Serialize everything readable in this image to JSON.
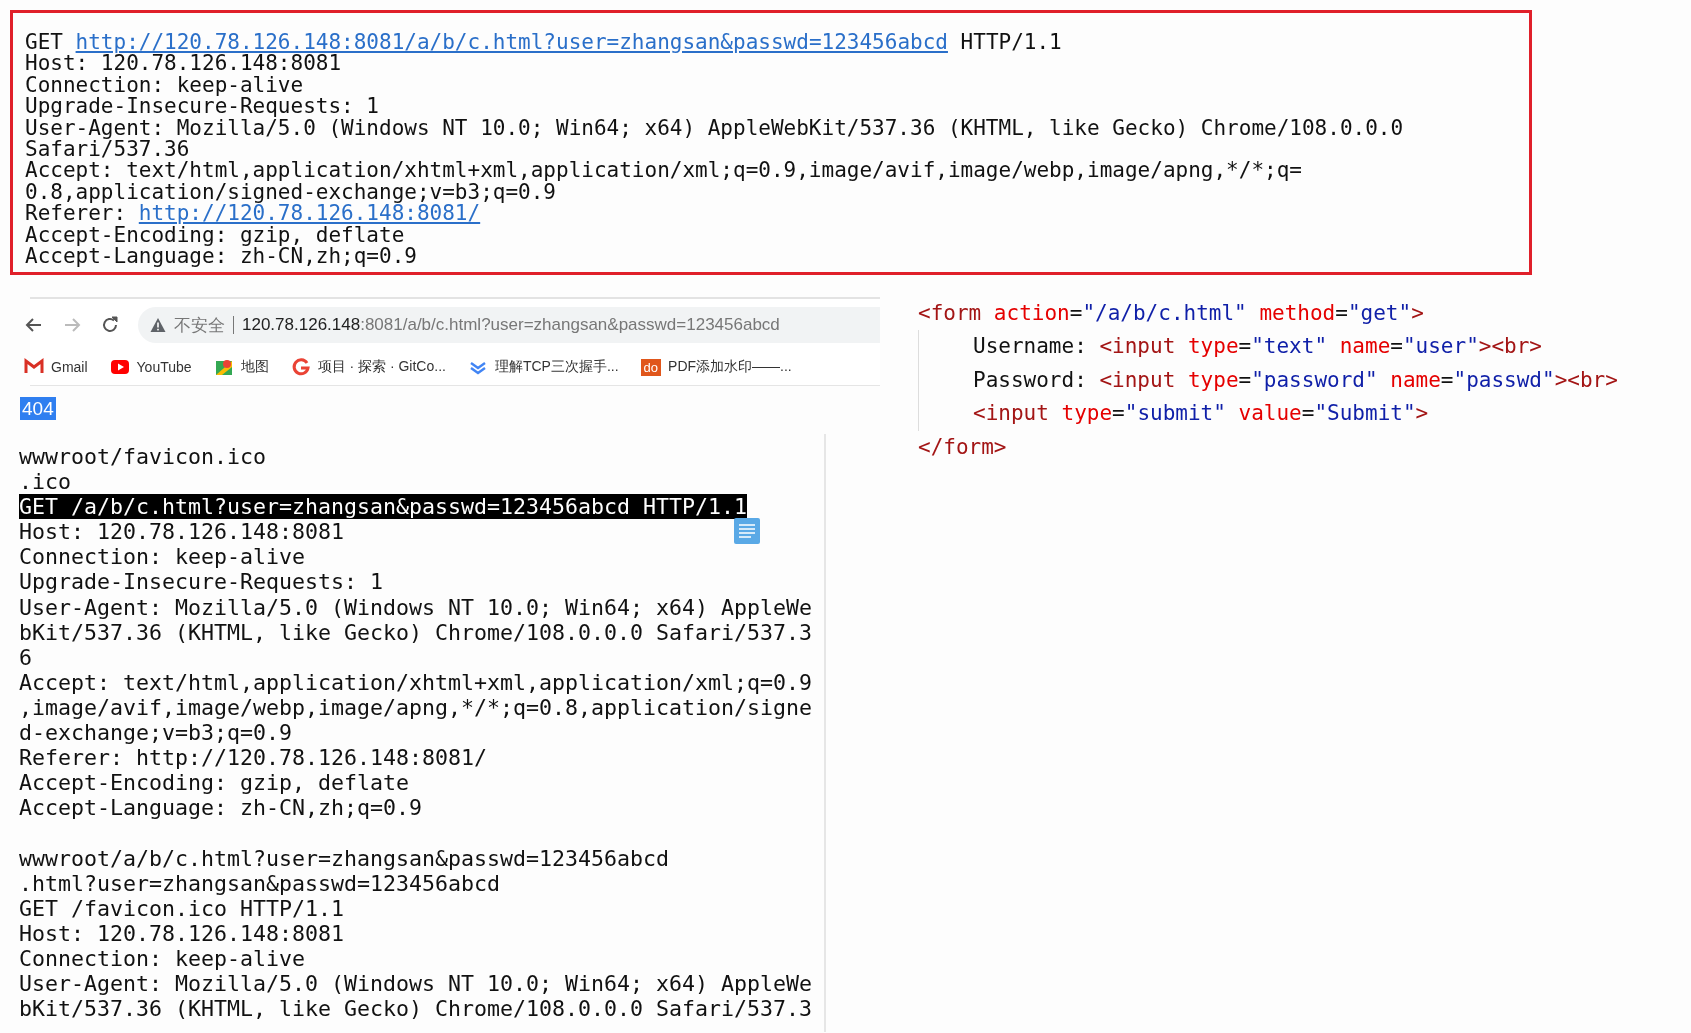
{
  "request_panel": {
    "lines": [
      [
        {
          "kind": "text",
          "text": "GET "
        },
        {
          "kind": "link",
          "text": "http://120.78.126.148:8081/a/b/c.html?user=zhangsan&passwd=123456abcd"
        },
        {
          "kind": "text",
          "text": " HTTP/1.1"
        }
      ],
      [
        {
          "kind": "text",
          "text": "Host: 120.78.126.148:8081"
        }
      ],
      [
        {
          "kind": "text",
          "text": "Connection: keep-alive"
        }
      ],
      [
        {
          "kind": "text",
          "text": "Upgrade-Insecure-Requests: 1"
        }
      ],
      [
        {
          "kind": "text",
          "text": "User-Agent: Mozilla/5.0 (Windows NT 10.0; Win64; x64) AppleWebKit/537.36 (KHTML, like Gecko) Chrome/108.0.0.0"
        }
      ],
      [
        {
          "kind": "text",
          "text": "Safari/537.36"
        }
      ],
      [
        {
          "kind": "text",
          "text": "Accept: text/html,application/xhtml+xml,application/xml;q=0.9,image/avif,image/webp,image/apng,*/*;q="
        }
      ],
      [
        {
          "kind": "text",
          "text": "0.8,application/signed-exchange;v=b3;q=0.9"
        }
      ],
      [
        {
          "kind": "text",
          "text": "Referer: "
        },
        {
          "kind": "link",
          "text": "http://120.78.126.148:8081/"
        }
      ],
      [
        {
          "kind": "text",
          "text": "Accept-Encoding: gzip, deflate"
        }
      ],
      [
        {
          "kind": "text",
          "text": "Accept-Language: zh-CN,zh;q=0.9"
        }
      ]
    ]
  },
  "browser": {
    "nav": [
      {
        "kind": "back",
        "disabled": false
      },
      {
        "kind": "forward",
        "disabled": true
      },
      {
        "kind": "reload",
        "disabled": false
      }
    ],
    "address": {
      "warning": "不安全",
      "host": "120.78.126.148",
      "rest": ":8081/a/b/c.html?user=zhangsan&passwd=123456abcd"
    },
    "bookmarks": [
      {
        "kind": "mail",
        "label": "Gmail"
      },
      {
        "kind": "play",
        "label": "YouTube"
      },
      {
        "kind": "map",
        "label": "地图"
      },
      {
        "kind": "ring",
        "label": "项目 · 探索 · GitCo..."
      },
      {
        "kind": "chevrons",
        "label": "理解TCP三次握手..."
      },
      {
        "kind": "badge",
        "badge_text": "do",
        "label": "PDF添加水印——..."
      }
    ],
    "page_text": {
      "text": "404",
      "selected": true
    }
  },
  "terminal": {
    "lines": [
      {
        "text": "wwwroot/favicon.ico",
        "selected": false
      },
      {
        "text": ".ico",
        "selected": false
      },
      {
        "text": "GET /a/b/c.html?user=zhangsan&passwd=123456abcd HTTP/1.1",
        "selected": true
      },
      {
        "text": "Host: 120.78.126.148:8081",
        "selected": false
      },
      {
        "text": "Connection: keep-alive",
        "selected": false
      },
      {
        "text": "Upgrade-Insecure-Requests: 1",
        "selected": false
      },
      {
        "text": "User-Agent: Mozilla/5.0 (Windows NT 10.0; Win64; x64) AppleWe",
        "selected": false
      },
      {
        "text": "bKit/537.36 (KHTML, like Gecko) Chrome/108.0.0.0 Safari/537.3",
        "selected": false
      },
      {
        "text": "6",
        "selected": false
      },
      {
        "text": "Accept: text/html,application/xhtml+xml,application/xml;q=0.9",
        "selected": false
      },
      {
        "text": ",image/avif,image/webp,image/apng,*/*;q=0.8,application/signe",
        "selected": false
      },
      {
        "text": "d-exchange;v=b3;q=0.9",
        "selected": false
      },
      {
        "text": "Referer: http://120.78.126.148:8081/",
        "selected": false
      },
      {
        "text": "Accept-Encoding: gzip, deflate",
        "selected": false
      },
      {
        "text": "Accept-Language: zh-CN,zh;q=0.9",
        "selected": false
      },
      {
        "text": "wwwroot/a/b/c.html?user=zhangsan&passwd=123456abcd",
        "selected": false,
        "gap_before": true
      },
      {
        "text": ".html?user=zhangsan&passwd=123456abcd",
        "selected": false
      },
      {
        "text": "GET /favicon.ico HTTP/1.1",
        "selected": false
      },
      {
        "text": "Host: 120.78.126.148:8081",
        "selected": false
      },
      {
        "text": "Connection: keep-alive",
        "selected": false
      },
      {
        "text": "User-Agent: Mozilla/5.0 (Windows NT 10.0; Win64; x64) AppleWe",
        "selected": false
      },
      {
        "text": "bKit/537.36 (KHTML, like Gecko) Chrome/108.0.0.0 Safari/537.3",
        "selected": false
      }
    ]
  },
  "code": {
    "lines": [
      {
        "tokens": [
          {
            "kind": "tag",
            "text": "<form "
          },
          {
            "kind": "attr",
            "text": "action"
          },
          {
            "kind": "text",
            "text": "="
          },
          {
            "kind": "value",
            "text": "\"/a/b/c.html\" "
          },
          {
            "kind": "attr",
            "text": "method"
          },
          {
            "kind": "text",
            "text": "="
          },
          {
            "kind": "value",
            "text": "\"get\""
          },
          {
            "kind": "tag",
            "text": ">"
          }
        ],
        "children": [
          {
            "tokens": [
              {
                "kind": "text",
                "text": "Username: "
              },
              {
                "kind": "tag",
                "text": "<input "
              },
              {
                "kind": "attr",
                "text": "type"
              },
              {
                "kind": "text",
                "text": "="
              },
              {
                "kind": "value",
                "text": "\"text\" "
              },
              {
                "kind": "attr",
                "text": "name"
              },
              {
                "kind": "text",
                "text": "="
              },
              {
                "kind": "value",
                "text": "\"user\""
              },
              {
                "kind": "tag",
                "text": "><br>"
              }
            ]
          },
          {
            "tokens": [
              {
                "kind": "text",
                "text": "Password: "
              },
              {
                "kind": "tag",
                "text": "<input "
              },
              {
                "kind": "attr",
                "text": "type"
              },
              {
                "kind": "text",
                "text": "="
              },
              {
                "kind": "value",
                "text": "\"password\" "
              },
              {
                "kind": "attr",
                "text": "name"
              },
              {
                "kind": "text",
                "text": "="
              },
              {
                "kind": "value",
                "text": "\"passwd\""
              },
              {
                "kind": "tag",
                "text": "><br>"
              }
            ]
          },
          {
            "tokens": [
              {
                "kind": "tag",
                "text": "<input "
              },
              {
                "kind": "attr",
                "text": "type"
              },
              {
                "kind": "text",
                "text": "="
              },
              {
                "kind": "value",
                "text": "\"submit\" "
              },
              {
                "kind": "attr",
                "text": "value"
              },
              {
                "kind": "text",
                "text": "="
              },
              {
                "kind": "value",
                "text": "\"Submit\""
              },
              {
                "kind": "tag",
                "text": ">"
              }
            ]
          }
        ]
      },
      {
        "tokens": [
          {
            "kind": "tag",
            "text": "</form>"
          }
        ]
      }
    ]
  }
}
